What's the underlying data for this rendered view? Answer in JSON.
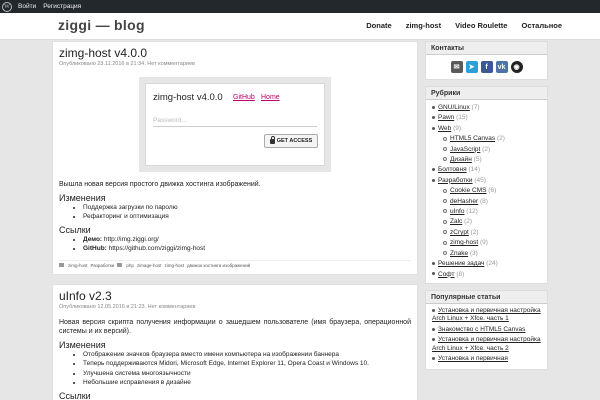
{
  "adminbar": {
    "login": "Войти",
    "register": "Регистрация"
  },
  "site": {
    "title": "ziggi — blog"
  },
  "nav": [
    "Donate",
    "zimg-host",
    "Video Roulette",
    "Остальное"
  ],
  "posts": {
    "p1": {
      "title": "zimg-host v4.0.0",
      "meta_prefix": "Опубликовано",
      "date": "23.11.2016",
      "time_prefix": "в",
      "time": "21:34",
      "comments": "Нет комментариев",
      "shot": {
        "title": "zimg-host v4.0.0",
        "github": "GitHub",
        "home": "Home",
        "placeholder": "Password...",
        "button": "GET ACCESS"
      },
      "intro": "Вышла новая версия простого движка хостинга изображений.",
      "changes_h": "Изменения",
      "changes": [
        "Поддержка загрузки по паролю",
        "Рефакторинг и оптимизация"
      ],
      "links_h": "Ссылки",
      "demo_label": "Демо:",
      "demo_url": "http://img.ziggi.org/",
      "github_label": "GitHub:",
      "github_url": "https://github.com/ziggi/zimg-host",
      "tags": [
        "zimg-host",
        "Разработки",
        "php",
        "zimage-host",
        "zimg-host",
        "движок хостинга изображений"
      ]
    },
    "p2": {
      "title": "uInfo v2.3",
      "meta_prefix": "Опубликовано",
      "date": "12.05.2016",
      "time_prefix": "в",
      "time": "21:23",
      "comments": "Нет комментариев",
      "intro": "Новая версия скрипта получения информации о зашедшем пользователе (имя браузера, операционной системы и их версий).",
      "changes_h": "Изменения",
      "changes": [
        "Отображение значков браузера вместо имени компьютера на изображении баннера",
        "Теперь поддерживаются Midori, Microsoft Edge, Internet Explorer 11, Opera Coast и Windows 10.",
        "Улучшена система многоязычности",
        "Небольшие исправления в дизайне"
      ],
      "links_h": "Ссылки"
    }
  },
  "sidebar": {
    "contacts_title": "Контакты",
    "contacts": [
      "✉",
      "➤",
      "f",
      "vk",
      "◉"
    ],
    "categories_title": "Рубрики",
    "categories": [
      {
        "label": "GNU/Linux",
        "count": "(7)",
        "sub": false
      },
      {
        "label": "Pawn",
        "count": "(15)",
        "sub": false
      },
      {
        "label": "Web",
        "count": "(9)",
        "sub": false
      },
      {
        "label": "HTML5 Canvas",
        "count": "(2)",
        "sub": true
      },
      {
        "label": "JavaScript",
        "count": "(2)",
        "sub": true
      },
      {
        "label": "Дизайн",
        "count": "(5)",
        "sub": true
      },
      {
        "label": "Болтовня",
        "count": "(14)",
        "sub": false
      },
      {
        "label": "Разработки",
        "count": "(45)",
        "sub": false
      },
      {
        "label": "Cookie CMS",
        "count": "(6)",
        "sub": true
      },
      {
        "label": "deHasher",
        "count": "(8)",
        "sub": true
      },
      {
        "label": "uInfo",
        "count": "(12)",
        "sub": true
      },
      {
        "label": "Zalc",
        "count": "(2)",
        "sub": true
      },
      {
        "label": "zCrypt",
        "count": "(2)",
        "sub": true
      },
      {
        "label": "zimg-host",
        "count": "(9)",
        "sub": true
      },
      {
        "label": "Znake",
        "count": "(3)",
        "sub": true
      },
      {
        "label": "Решение задач",
        "count": "(24)",
        "sub": false
      },
      {
        "label": "Софт",
        "count": "(8)",
        "sub": false
      }
    ],
    "popular_title": "Популярные статьи",
    "popular": [
      "Установка и первичная настройка Arch Linux + Xfce. часть 1",
      "Знакомство с HTML5 Canvas",
      "Установка и первичная настройка Arch Linux + Xfce. часть 2",
      "Установка и первичная"
    ]
  }
}
